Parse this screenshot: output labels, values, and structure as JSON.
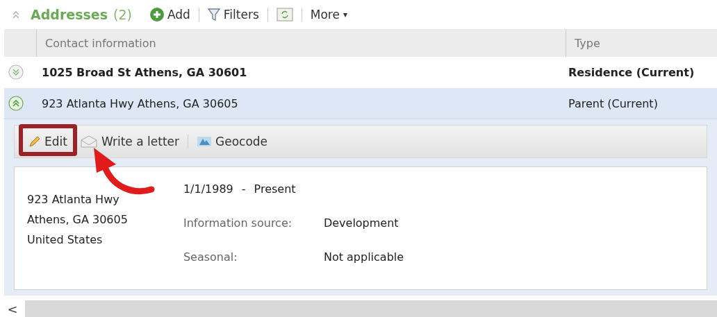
{
  "section": {
    "title": "Addresses",
    "count": "(2)",
    "expanded": true,
    "actions": [
      {
        "kind": "add",
        "label": "Add"
      },
      {
        "kind": "filter",
        "label": "Filters"
      },
      {
        "kind": "refresh"
      },
      {
        "kind": "more",
        "label": "More",
        "caret": "▾"
      }
    ]
  },
  "table": {
    "columns": [
      "Contact information",
      "Type"
    ],
    "rows": [
      {
        "address": "1025 Broad St Athens, GA 30601",
        "type": "Residence (Current)",
        "primary": true,
        "expanded": false,
        "selected": false
      },
      {
        "address": "923 Atlanta Hwy Athens, GA 30605",
        "type": "Parent (Current)",
        "primary": false,
        "expanded": true,
        "selected": true
      }
    ]
  },
  "detail": {
    "toolbar": [
      {
        "kind": "edit",
        "label": "Edit",
        "highlighted": true
      },
      {
        "kind": "letter",
        "label": "Write a letter",
        "highlighted": false
      },
      {
        "kind": "geocode",
        "label": "Geocode",
        "highlighted": false
      }
    ],
    "address_lines": [
      "923 Atlanta Hwy",
      "Athens, GA  30605",
      "United States"
    ],
    "date_from": "1/1/1989",
    "date_sep": "-",
    "date_to": "Present",
    "fields": [
      {
        "label": "Information source:",
        "value": "Development"
      },
      {
        "label": "Seasonal:",
        "value": "Not applicable"
      }
    ]
  },
  "scrollbar": {
    "left_arrow": "<"
  }
}
